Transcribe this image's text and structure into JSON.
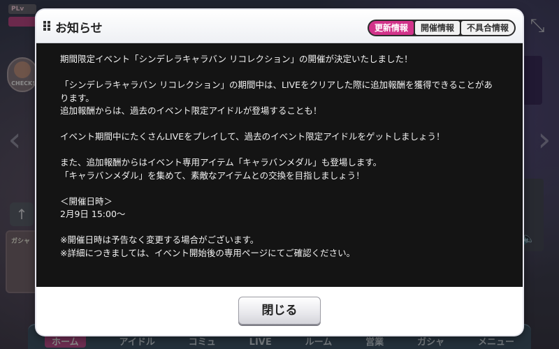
{
  "background": {
    "plv_label": "PLv",
    "check_label": "CHECK!",
    "gacha_label": "ガシャ",
    "nav_arrow_left": "‹",
    "nav_arrow_right": "›",
    "up_arrow": "↑",
    "expand_icon": "⤡",
    "speaker_icon": "🔈"
  },
  "bottom_nav": {
    "items": [
      "ホーム",
      "アイドル",
      "コミュ",
      "LIVE",
      "ルーム",
      "営業",
      "ガシャ",
      "メニュー"
    ]
  },
  "modal": {
    "title": "お知らせ",
    "tabs": [
      {
        "label": "更新情報",
        "active": true
      },
      {
        "label": "開催情報",
        "active": false
      },
      {
        "label": "不具合情報",
        "active": false
      }
    ],
    "body": {
      "line1": "期間限定イベント「シンデレラキャラバン リコレクション」の開催が決定いたしました！",
      "line2": "「シンデレラキャラバン リコレクション」の期間中は、LIVEをクリアした際に追加報酬を獲得できることがあります。",
      "line3": "追加報酬からは、過去のイベント限定アイドルが登場することも！",
      "line4": "イベント期間中にたくさんLIVEをプレイして、過去のイベント限定アイドルをゲットしましょう！",
      "line5": "また、追加報酬からはイベント専用アイテム「キャラバンメダル」も登場します。",
      "line6": "「キャラバンメダル」を集めて、素敵なアイテムとの交換を目指しましょう！",
      "schedule_heading": "＜開催日時＞",
      "schedule_date": "2月9日 15:00〜",
      "note1": "※開催日時は予告なく変更する場合がございます。",
      "note2": "※詳細につきましては、イベント開始後の専用ページにてご確認ください。"
    },
    "close_label": "閉じる"
  },
  "colors": {
    "tab_active": "#d2338a",
    "body_bg": "#141414",
    "home_nav": "#c65294"
  }
}
